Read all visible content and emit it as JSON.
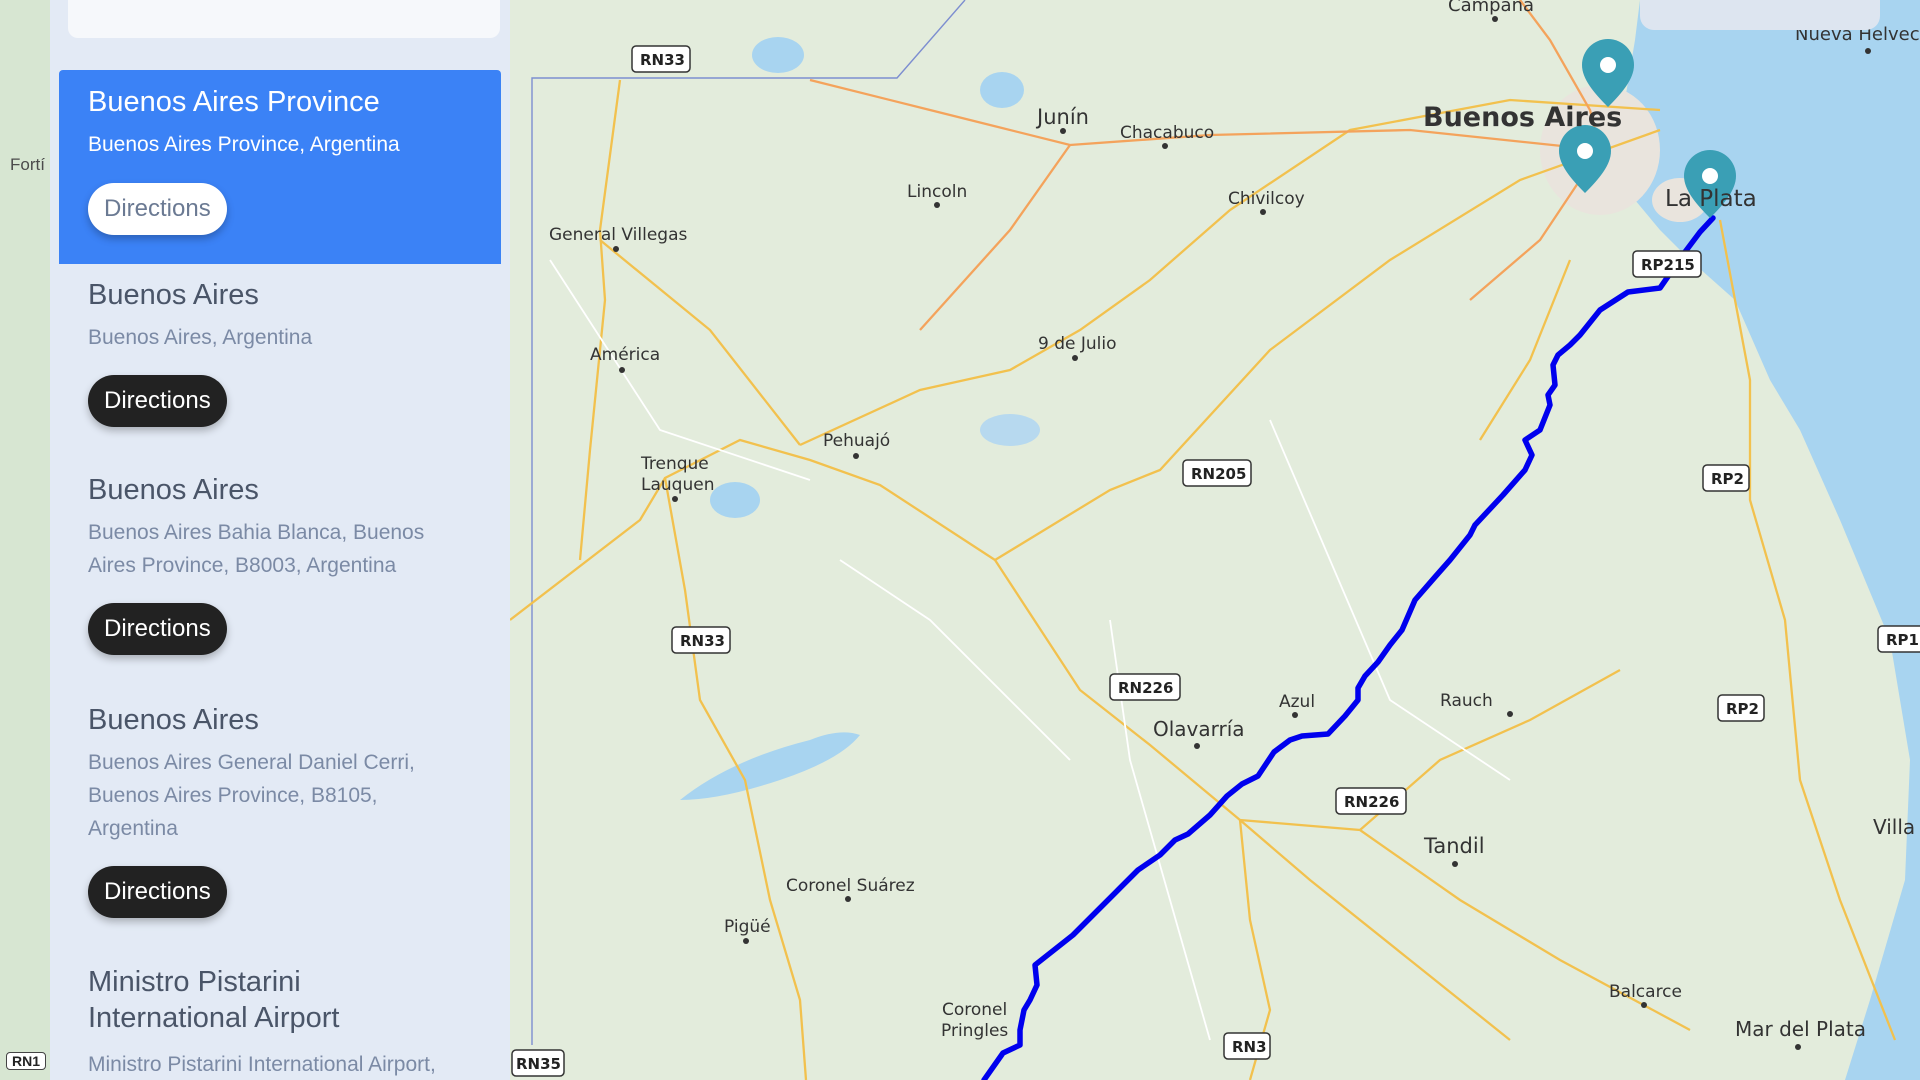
{
  "left_strip": {
    "label": "Fortí",
    "road": "RN1"
  },
  "results": [
    {
      "title": "Buenos Aires Province",
      "address": "Buenos Aires Province, Argentina",
      "button": "Directions"
    },
    {
      "title": "Buenos Aires",
      "address": "Buenos Aires, Argentina",
      "button": "Directions"
    },
    {
      "title": "Buenos Aires",
      "address": "Buenos Aires Bahia Blanca, Buenos Aires Province, B8003, Argentina",
      "button": "Directions"
    },
    {
      "title": "Buenos Aires",
      "address": "Buenos Aires General Daniel Cerri, Buenos Aires Province, B8105, Argentina",
      "button": "Directions"
    },
    {
      "title": "Ministro Pistarini International Airport",
      "address": "Ministro Pistarini International Airport,"
    }
  ],
  "map": {
    "places": [
      "Campana",
      "Nueva Helvec",
      "Buenos Aires",
      "La Plata",
      "Junín",
      "Chacabuco",
      "Lincoln",
      "Chivilcoy",
      "General Villegas",
      "América",
      "9 de Julio",
      "Pehuajó",
      "Trenque",
      "Lauquen",
      "Azul",
      "Olavarría",
      "Rauch",
      "Tandil",
      "Coronel Suárez",
      "Pigüé",
      "Coronel",
      "Pringles",
      "Balcarce",
      "Mar del Plata",
      "Villa"
    ],
    "roads": [
      "RN33",
      "RN33",
      "RN205",
      "RN226",
      "RN226",
      "RP215",
      "RP2",
      "RP2",
      "RP1",
      "RN3",
      "RN35"
    ],
    "colors": {
      "route": "#0000ee",
      "marker": "#3a9fb5",
      "water": "#a8d4f0",
      "land": "#e3ecdc",
      "road": "#f2c14e"
    }
  }
}
